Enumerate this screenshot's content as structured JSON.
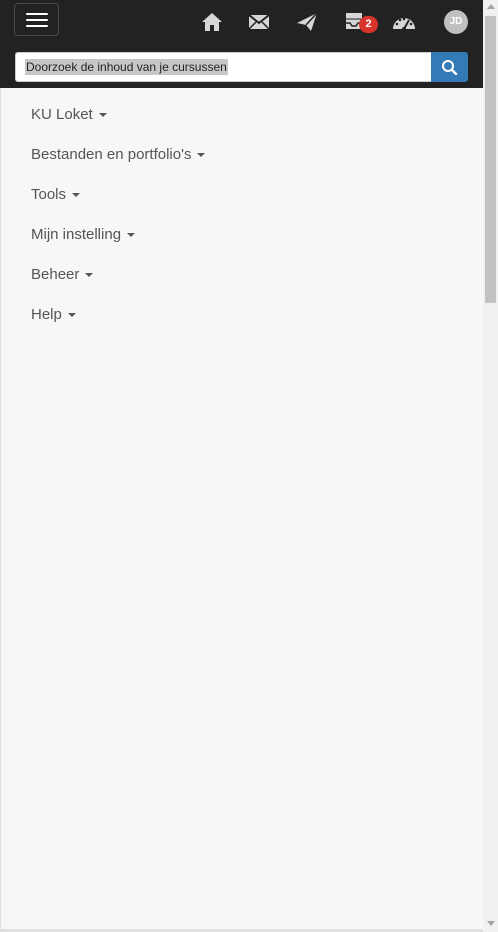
{
  "header": {
    "menu_toggle_icon": "hamburger-menu-icon",
    "nav_icons": [
      "home-icon",
      "mail-icon",
      "send-icon",
      "inbox-icon",
      "dashboard-icon"
    ],
    "notifications": {
      "count": "2",
      "color": "#d9342b"
    },
    "avatar": {
      "initials": "JD"
    }
  },
  "search": {
    "placeholder": "Doorzoek de inhoud van je cursussen",
    "button_icon": "search-icon",
    "button_color": "#337ab7"
  },
  "menu": {
    "items": [
      {
        "label": "KU Loket"
      },
      {
        "label": "Bestanden en portfolio's"
      },
      {
        "label": "Tools"
      },
      {
        "label": "Mijn instelling"
      },
      {
        "label": "Beheer"
      },
      {
        "label": "Help"
      }
    ]
  },
  "colors": {
    "topbar": "#222222",
    "page_background": "#f7f7f7",
    "menu_text": "#555555"
  }
}
